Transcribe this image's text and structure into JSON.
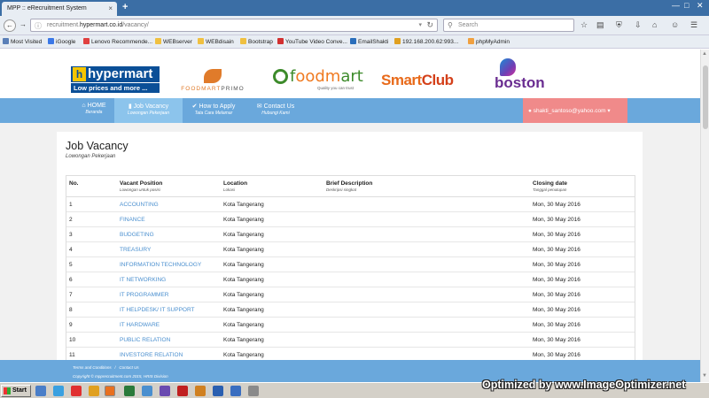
{
  "browser": {
    "tab_title": "MPP :: eRecruitment System",
    "tab_close": "×",
    "new_tab": "+",
    "url_prefix": "recruitment.",
    "url_domain": "hypermart.co.id",
    "url_path": "/vacancy/",
    "search_placeholder": "Search",
    "window_controls": [
      "—",
      "□",
      "✕"
    ],
    "toolbar_icons": [
      "star-icon",
      "reading-list-icon",
      "shield-icon",
      "download-icon",
      "home-icon",
      "chat-icon",
      "menu-icon"
    ]
  },
  "bookmarks": [
    {
      "label": "Most Visited",
      "color": "#5a7fb8"
    },
    {
      "label": "iGoogle",
      "color": "#3b78e7"
    },
    {
      "label": "Lenovo Recommende...",
      "color": "#e04040"
    },
    {
      "label": "WEBserver",
      "color": "#f0c040"
    },
    {
      "label": "WEBdisain",
      "color": "#f0c040"
    },
    {
      "label": "Bootstrap",
      "color": "#f0c040"
    },
    {
      "label": "YouTube Video Conve...",
      "color": "#d23030"
    },
    {
      "label": "EmailShakti",
      "color": "#2a6ebb"
    },
    {
      "label": "192.168.200.62:993...",
      "color": "#e0a020"
    },
    {
      "label": "phpMyAdmin",
      "color": "#f0a040"
    }
  ],
  "brands": {
    "hypermart_letter": "h",
    "hypermart_name": "hypermart",
    "hypermart_tagline": "Low prices and more ...",
    "foodmart_primo_a": "FOODMART",
    "foodmart_primo_b": "PRIMO",
    "foodmart_a": "f",
    "foodmart_b": "oodm",
    "foodmart_c": "art",
    "foodmart_tagline": "Quality you can trust",
    "smartclub_a": "Smart",
    "smartclub_b": "Club",
    "boston": "boston"
  },
  "menu": {
    "items": [
      {
        "label": "HOME",
        "sub": "Beranda"
      },
      {
        "label": "Job Vacancy",
        "sub": "Lowongan Pekerjaan"
      },
      {
        "label": "How to Apply",
        "sub": "Tata Cara Melamar"
      },
      {
        "label": "Contact Us",
        "sub": "Hubungi Kami"
      }
    ],
    "user_email": "shakti_santoso@yahoo.com",
    "user_caret": "▾"
  },
  "page": {
    "title": "Job Vacancy",
    "subtitle": "Lowongan Pekerjaan"
  },
  "table": {
    "headers": [
      {
        "label": "No.",
        "sub": ""
      },
      {
        "label": "Vacant Position",
        "sub": "Lowongan untuk posisi"
      },
      {
        "label": "Location",
        "sub": "Lokasi"
      },
      {
        "label": "Brief Description",
        "sub": "Deskripsi singkat"
      },
      {
        "label": "Closing date",
        "sub": "Tanggal penutupan"
      }
    ],
    "rows": [
      {
        "no": "1",
        "position": "ACCOUNTING",
        "location": "Kota Tangerang",
        "description": "",
        "closing": "Mon, 30 May 2016"
      },
      {
        "no": "2",
        "position": "FINANCE",
        "location": "Kota Tangerang",
        "description": "",
        "closing": "Mon, 30 May 2016"
      },
      {
        "no": "3",
        "position": "BUDGETING",
        "location": "Kota Tangerang",
        "description": "",
        "closing": "Mon, 30 May 2016"
      },
      {
        "no": "4",
        "position": "TREASURY",
        "location": "Kota Tangerang",
        "description": "",
        "closing": "Mon, 30 May 2016"
      },
      {
        "no": "5",
        "position": "INFORMATION TECHNOLOGY",
        "location": "Kota Tangerang",
        "description": "",
        "closing": "Mon, 30 May 2016"
      },
      {
        "no": "6",
        "position": "IT NETWORKING",
        "location": "Kota Tangerang",
        "description": "",
        "closing": "Mon, 30 May 2016"
      },
      {
        "no": "7",
        "position": "IT PROGRAMMER",
        "location": "Kota Tangerang",
        "description": "",
        "closing": "Mon, 30 May 2016"
      },
      {
        "no": "8",
        "position": "IT HELPDESK/ IT SUPPORT",
        "location": "Kota Tangerang",
        "description": "",
        "closing": "Mon, 30 May 2016"
      },
      {
        "no": "9",
        "position": "IT HARDWARE",
        "location": "Kota Tangerang",
        "description": "",
        "closing": "Mon, 30 May 2016"
      },
      {
        "no": "10",
        "position": "PUBLIC RELATION",
        "location": "Kota Tangerang",
        "description": "",
        "closing": "Mon, 30 May 2016"
      },
      {
        "no": "11",
        "position": "INVESTORE RELATION",
        "location": "Kota Tangerang",
        "description": "",
        "closing": "Mon, 30 May 2016"
      }
    ]
  },
  "footer": {
    "terms": "Terms and Conditions",
    "separator": "/",
    "contact": "Contact Us",
    "copyright": "Copyright © mpprecruitment.com 2015, HRIS Division"
  },
  "taskbar": {
    "start_label": "Start",
    "watermark": "Optimized by www.ImageOptimizer.net"
  },
  "colors": {
    "menu_blue": "#6aa8dc",
    "active_tab": "#8cc4ec",
    "user_button": "#f08a8a",
    "link": "#4a8fcf"
  }
}
